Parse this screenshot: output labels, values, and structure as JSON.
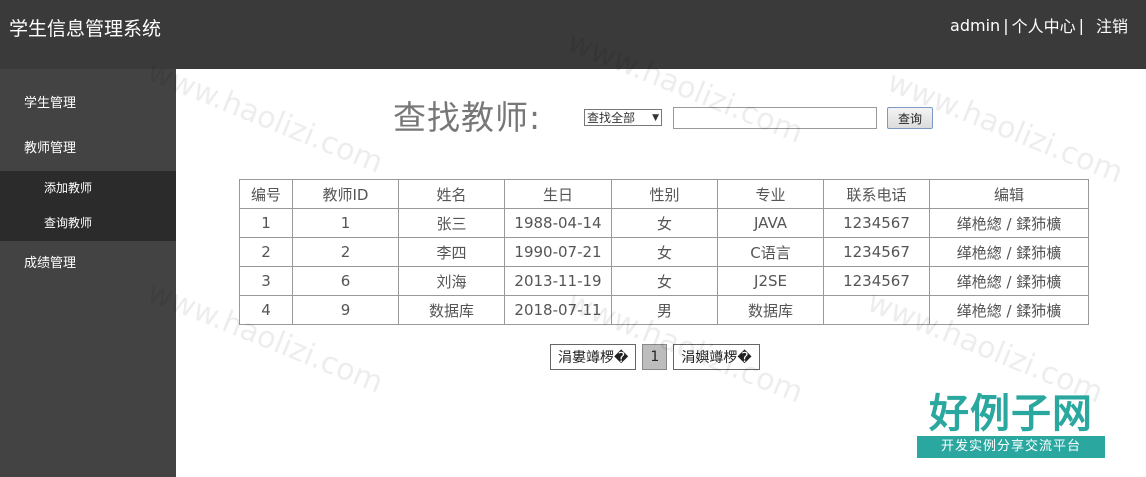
{
  "header": {
    "app_title": "学生信息管理系统",
    "user": "admin",
    "separator": "|",
    "profile_link": "个人中心",
    "logout_link": "注销"
  },
  "sidebar": {
    "items": [
      {
        "label": "学生管理"
      },
      {
        "label": "教师管理"
      },
      {
        "label": "成绩管理"
      }
    ],
    "teacher_submenu": [
      {
        "label": "添加教师"
      },
      {
        "label": "查询教师"
      }
    ]
  },
  "search": {
    "title": "查找教师:",
    "select_value": "查找全部",
    "input_value": "",
    "button_label": "查询"
  },
  "table": {
    "headers": [
      "编号",
      "教师ID",
      "姓名",
      "生日",
      "性别",
      "专业",
      "联系电话",
      "编辑"
    ],
    "rows": [
      [
        "1",
        "1",
        "张三",
        "1988-04-14",
        "女",
        "JAVA",
        "1234567"
      ],
      [
        "2",
        "2",
        "李四",
        "1990-07-21",
        "女",
        "C语言",
        "1234567"
      ],
      [
        "3",
        "6",
        "刘海",
        "2013-11-19",
        "女",
        "J2SE",
        "1234567"
      ],
      [
        "4",
        "9",
        "数据库",
        "2018-07-11",
        "男",
        "数据库",
        ""
      ]
    ],
    "edit_label": "缂栬緫",
    "edit_sep": " / ",
    "delete_label": "鍒犻櫎"
  },
  "pager": {
    "prev_label": "涓婁竴椤�",
    "current_page": "1",
    "next_label": "涓嬩竴椤�"
  },
  "watermark": {
    "text": "www.haolizi.com"
  },
  "logo": {
    "main": "好例子网",
    "sub": "开发实例分享交流平台"
  },
  "colors": {
    "topbar": "#3a3a3a",
    "sidebar": "#434343",
    "submenu": "#2b2b2b",
    "logo": "#2aa8a0"
  }
}
